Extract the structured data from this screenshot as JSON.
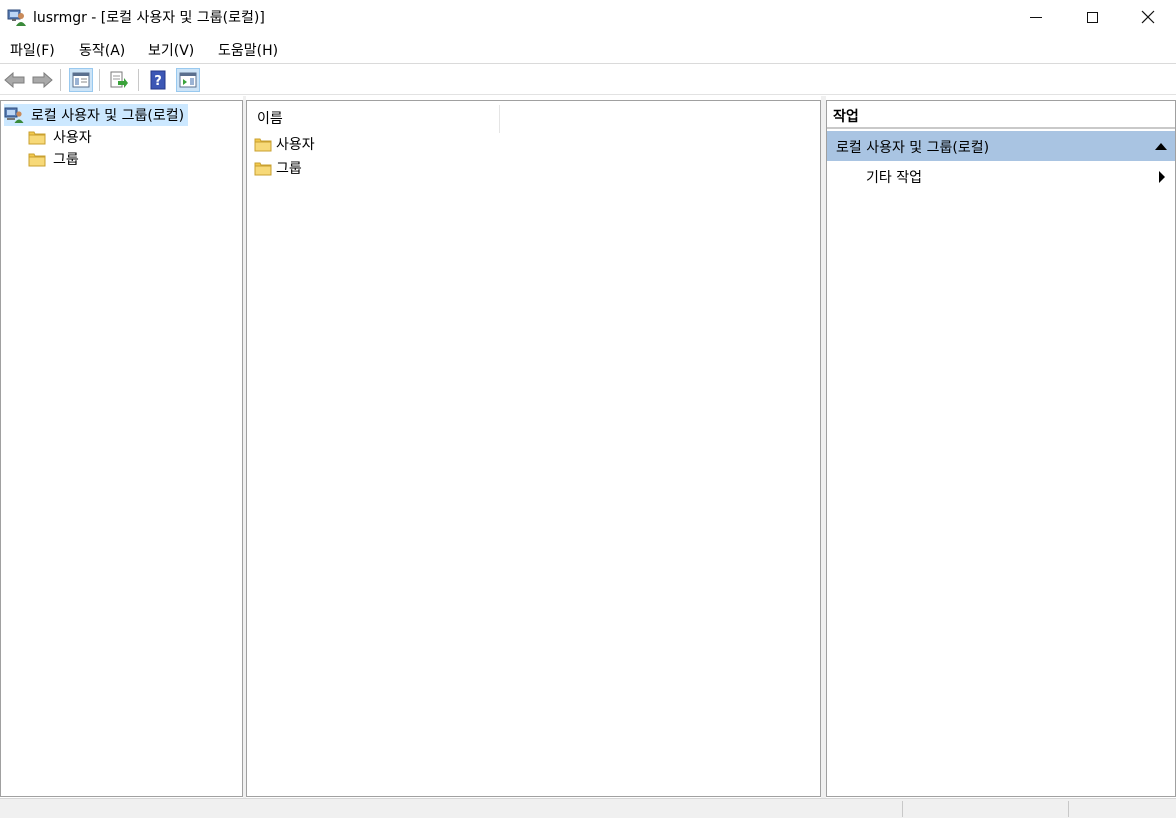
{
  "window": {
    "title": "lusrmgr - [로컬 사용자 및 그룹(로컬)]"
  },
  "menu": {
    "file": "파일(F)",
    "action": "동작(A)",
    "view": "보기(V)",
    "help": "도움말(H)"
  },
  "toolbar": {
    "icons": [
      "back-arrow-icon",
      "forward-arrow-icon",
      "show-hide-console-tree-icon",
      "export-list-icon",
      "help-icon",
      "show-hide-action-pane-icon"
    ]
  },
  "tree": {
    "root": "로컬 사용자 및 그룹(로컬)",
    "children": [
      "사용자",
      "그룹"
    ]
  },
  "list": {
    "column_name": "이름",
    "items": [
      "사용자",
      "그룹"
    ]
  },
  "actions": {
    "header": "작업",
    "group_title": "로컬 사용자 및 그룹(로컬)",
    "items": [
      "기타 작업"
    ]
  },
  "colors": {
    "tree_selected": "#cce8ff",
    "actions_group_bg": "#a9c4e2",
    "folder": "#f2c94c"
  }
}
